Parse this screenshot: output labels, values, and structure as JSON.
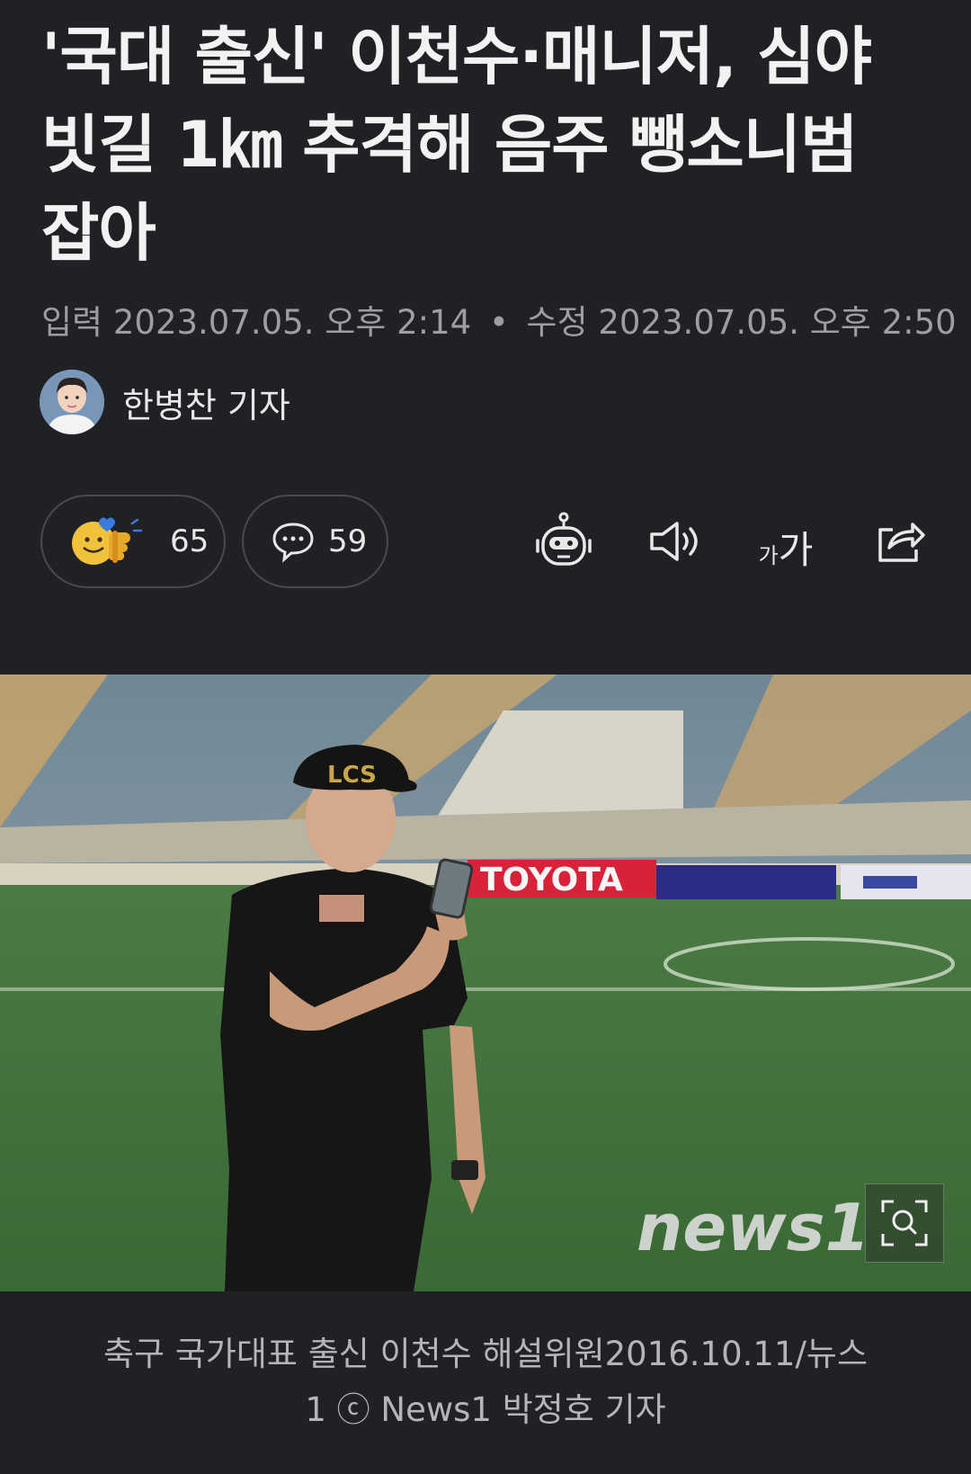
{
  "article": {
    "title": "'국대 출신' 이천수·매니저, 심야 빗길 1㎞ 추격해 음주 뺑소니범 잡아",
    "meta": {
      "published_label": "입력",
      "published": "2023.07.05. 오후 2:14",
      "separator": "•",
      "modified_label": "수정",
      "modified": "2023.07.05. 오후 2:50"
    },
    "author": {
      "name": "한병찬 기자"
    }
  },
  "actions": {
    "like_count": "65",
    "comment_count": "59",
    "icons": [
      "like-emoji-icon",
      "comment-bubble-icon",
      "robot-summary-icon",
      "speaker-icon",
      "font-size-icon",
      "share-icon"
    ],
    "font_size_label_small": "가",
    "font_size_label_large": "가"
  },
  "photo": {
    "watermark": "news1",
    "board_texts": [
      "TOYOTA"
    ],
    "cap_text": "LCS",
    "zoom_icon": "zoom-icon",
    "caption_line1": "축구 국가대표 출신 이천수 해설위원2016.10.11/뉴스",
    "caption_line2": "1 ⓒ News1 박정호 기자"
  },
  "colors": {
    "background": "#202124",
    "text": "#f2f2f2",
    "meta": "#9e9ea0",
    "caption_bg": "#262628",
    "pill_border": "#4a4a4d"
  }
}
